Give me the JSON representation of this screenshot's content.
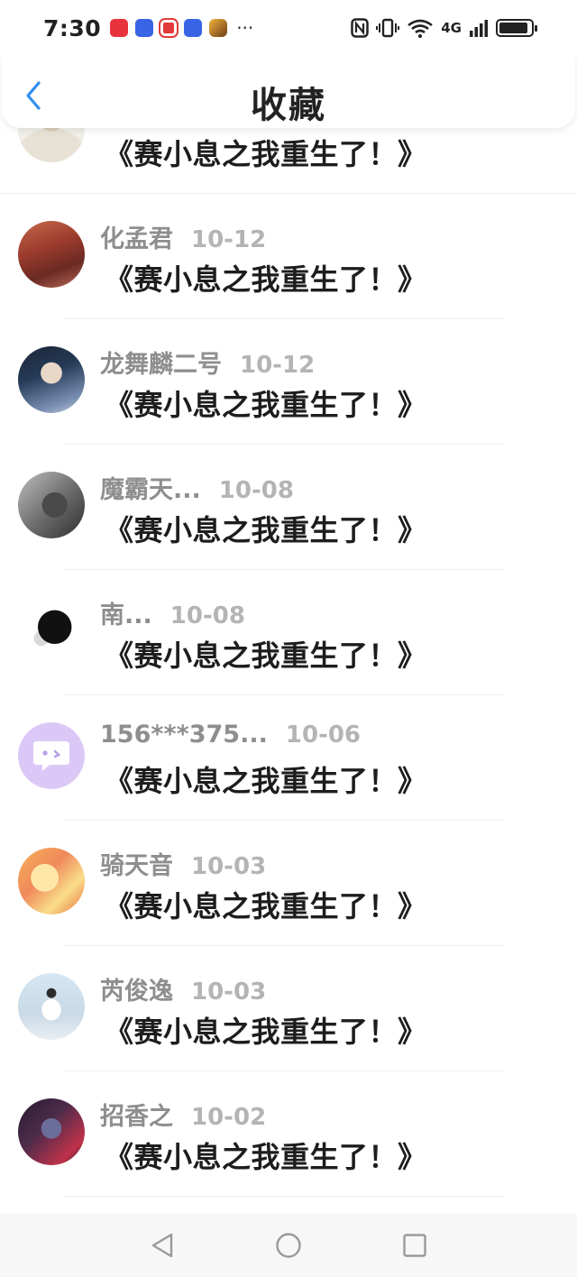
{
  "status_bar": {
    "time": "7:30",
    "notification_icons": [
      "huawei-store-icon",
      "baidu-icon",
      "red-app-icon",
      "baidu-icon",
      "game-icon"
    ],
    "more": "···",
    "network_label": "4G"
  },
  "header": {
    "title": "收藏"
  },
  "items": [
    {
      "username": "",
      "date": "",
      "title": "《赛小息之我重生了！》"
    },
    {
      "username": "化孟君",
      "date": "10-12",
      "title": "《赛小息之我重生了！》"
    },
    {
      "username": "龙舞麟二号",
      "date": "10-12",
      "title": "《赛小息之我重生了！》"
    },
    {
      "username": "魔霸天...",
      "date": "10-08",
      "title": "《赛小息之我重生了！》"
    },
    {
      "username": "南...",
      "date": "10-08",
      "title": "《赛小息之我重生了！》"
    },
    {
      "username": "156***375...",
      "date": "10-06",
      "title": "《赛小息之我重生了！》"
    },
    {
      "username": "骑天音",
      "date": "10-03",
      "title": "《赛小息之我重生了！》"
    },
    {
      "username": "芮俊逸",
      "date": "10-03",
      "title": "《赛小息之我重生了！》"
    },
    {
      "username": "招香之",
      "date": "10-02",
      "title": "《赛小息之我重生了！》"
    }
  ],
  "colors": {
    "accent": "#2f8ff0",
    "username": "#8e8e8e",
    "date": "#b4b4b4",
    "title_text": "#1d1d1d"
  }
}
